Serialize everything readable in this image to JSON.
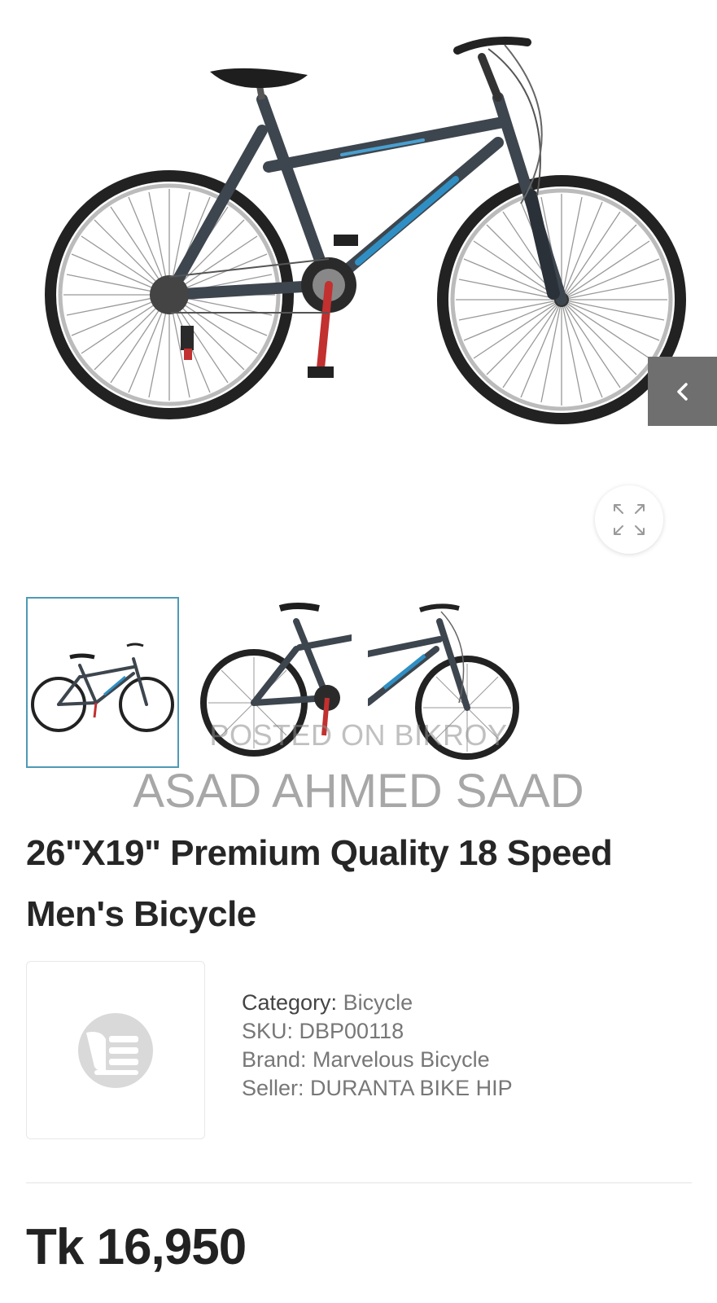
{
  "gallery": {
    "main_image": "bicycle-side-view",
    "prev_icon": "chevron-left-icon",
    "zoom_icon": "expand-icon",
    "thumbnails": [
      "bicycle-full-view",
      "bicycle-rear-half",
      "bicycle-front-half"
    ],
    "active_thumbnail": 0
  },
  "watermark": {
    "line1": "POSTED ON BIKROY",
    "line2": "ASAD AHMED SAAD"
  },
  "product": {
    "title": "26\"X19\" Premium Quality 18 Speed Men's Bicycle",
    "category_label": "Category:",
    "category_value": "Bicycle",
    "sku": "SKU: DBP00118",
    "brand": "Brand: Marvelous Bicycle",
    "seller": "Seller: DURANTA BIKE HIP",
    "price": "Tk 16,950"
  },
  "colors": {
    "frame": "#3d464e",
    "accent_blue": "#2f8fc4",
    "thumb_border": "#4e9ab6",
    "nav_button": "#6f6f6f"
  }
}
